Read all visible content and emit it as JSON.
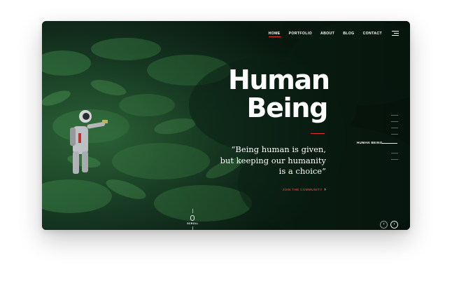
{
  "nav": {
    "items": [
      {
        "label": "HOME",
        "active": true
      },
      {
        "label": "PORTFOLIO",
        "active": false
      },
      {
        "label": "ABOUT",
        "active": false
      },
      {
        "label": "BLOG",
        "active": false
      },
      {
        "label": "CONTACT",
        "active": false
      }
    ],
    "menu_icon": "hamburger-menu-icon"
  },
  "hero": {
    "title_line1": "Human",
    "title_line2": "Being",
    "quote_line1": "“Being human is given,",
    "quote_line2": "but keeping our humanity",
    "quote_line3": "is a choice”",
    "cta_label": "JOIN THE COMMUNITY",
    "cta_icon": "chevron-right-icon"
  },
  "slider": {
    "current_label": "HUMAN BEING",
    "prev_icon": "arrow-left-icon",
    "next_icon": "arrow-right-icon"
  },
  "scroll": {
    "label": "SCROLL",
    "icon": "mouse-icon"
  },
  "colors": {
    "accent": "#e0322f",
    "forest_dark": "#0e2417",
    "forest_mid": "#1f4a2b",
    "text": "#ffffff"
  }
}
